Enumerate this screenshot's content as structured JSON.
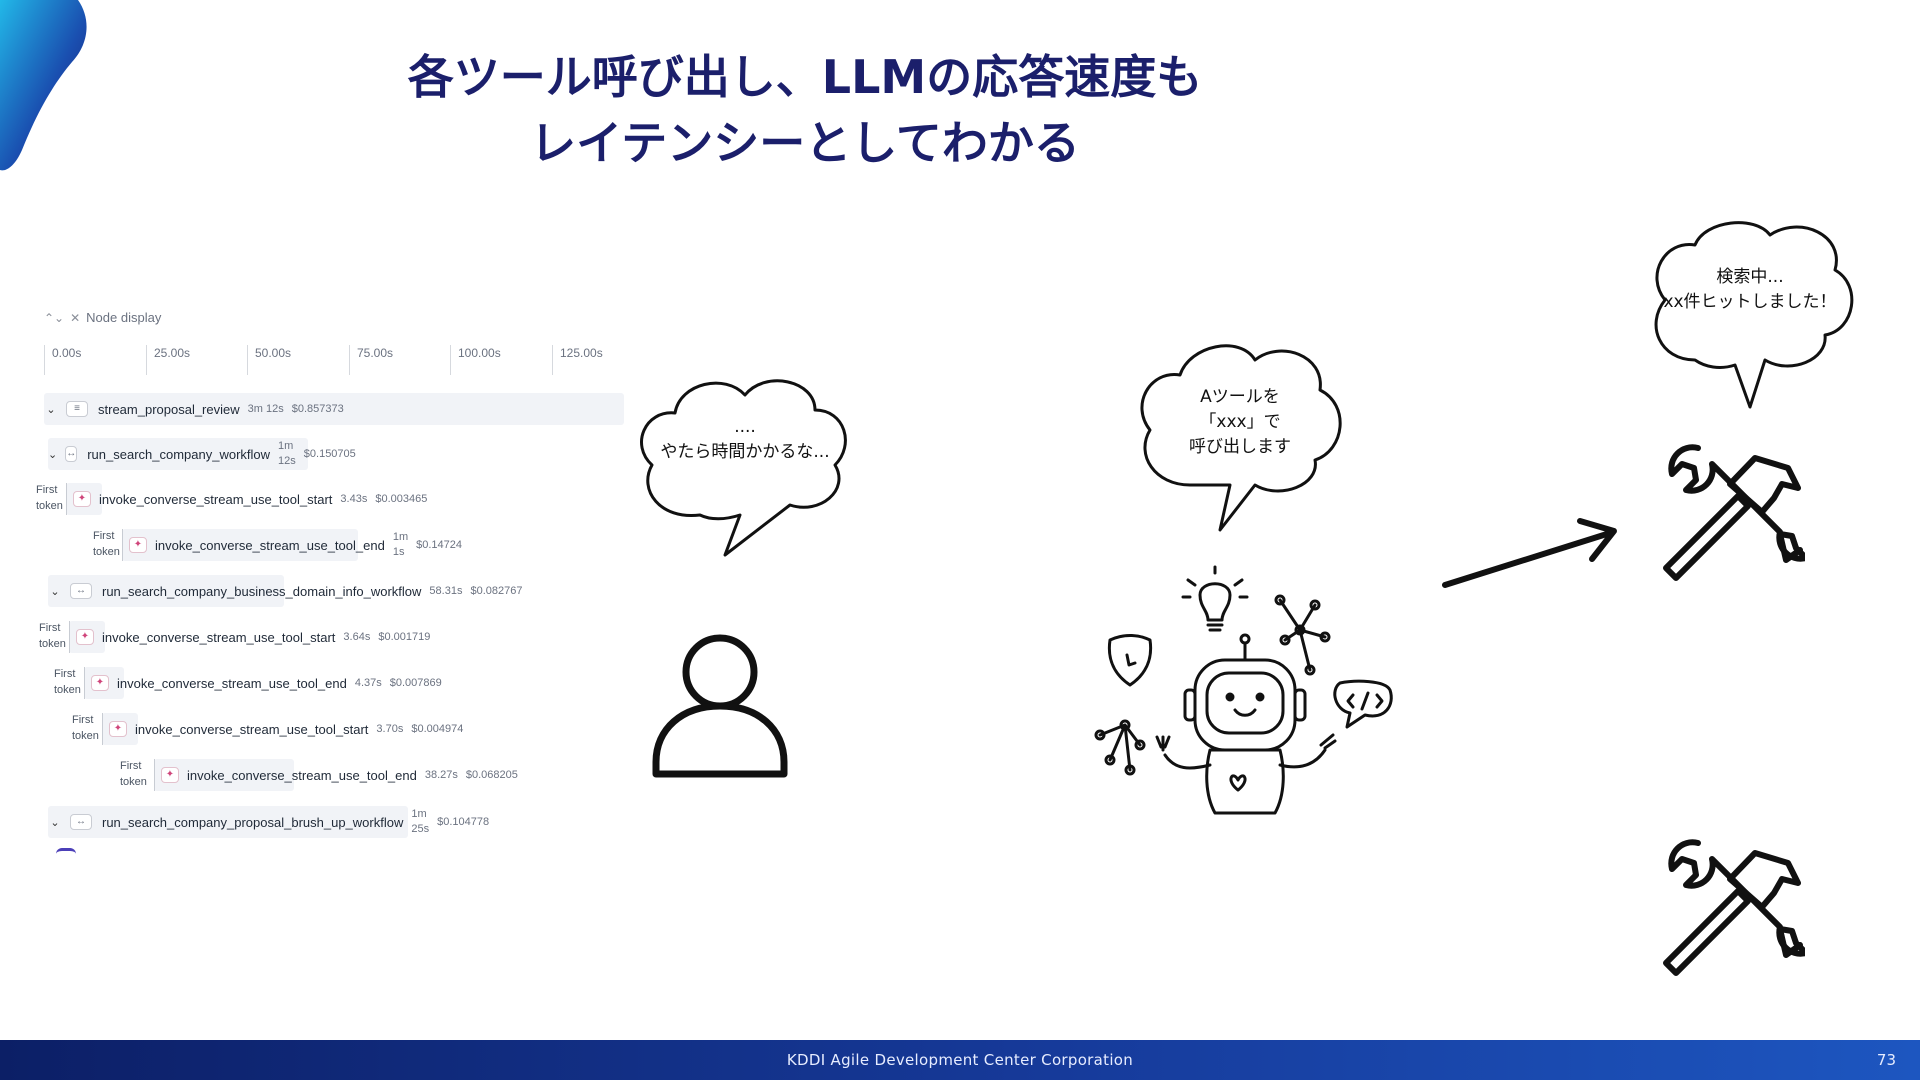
{
  "slide": {
    "title_line1": "各ツール呼び出し、LLMの応答速度も",
    "title_line2": "レイテンシーとしてわかる",
    "footer_company": "KDDI Agile Development Center Corporation",
    "page_number": "73"
  },
  "trace": {
    "node_display_label": "Node display",
    "ticks": [
      "0.00s",
      "25.00s",
      "50.00s",
      "75.00s",
      "100.00s",
      "125.00s"
    ],
    "rows": [
      {
        "name": "stream_proposal_review",
        "duration": "3m 12s",
        "cost": "$0.857373"
      },
      {
        "name": "run_search_company_workflow",
        "duration_a": "1m",
        "duration_b": "12s",
        "cost": "$0.150705"
      },
      {
        "first_a": "First",
        "first_b": "token",
        "name": "invoke_converse_stream_use_tool_start",
        "duration": "3.43s",
        "cost": "$0.003465"
      },
      {
        "first_a": "First",
        "first_b": "token",
        "name": "invoke_converse_stream_use_tool_end",
        "duration_a": "1m",
        "duration_b": "1s",
        "cost": "$0.14724"
      },
      {
        "name": "run_search_company_business_domain_info_workflow",
        "duration": "58.31s",
        "cost": "$0.082767"
      },
      {
        "first_a": "First",
        "first_b": "token",
        "name": "invoke_converse_stream_use_tool_start",
        "duration": "3.64s",
        "cost": "$0.001719"
      },
      {
        "first_a": "First",
        "first_b": "token",
        "name": "invoke_converse_stream_use_tool_end",
        "duration": "4.37s",
        "cost": "$0.007869"
      },
      {
        "first_a": "First",
        "first_b": "token",
        "name": "invoke_converse_stream_use_tool_start",
        "duration": "3.70s",
        "cost": "$0.004974"
      },
      {
        "first_a": "First",
        "first_b": "token",
        "name": "invoke_converse_stream_use_tool_end",
        "duration": "38.27s",
        "cost": "$0.068205"
      },
      {
        "name": "run_search_company_proposal_brush_up_workflow",
        "duration_a": "1m",
        "duration_b": "25s",
        "cost": "$0.104778"
      }
    ]
  },
  "bubbles": {
    "user_line1": "....",
    "user_line2": "やたら時間かかるな...",
    "agent_line1": "Aツールを",
    "agent_line2": "「xxx」で",
    "agent_line3": "呼び出します",
    "tool_line1": "検索中...",
    "tool_line2": "xx件ヒットしました！"
  },
  "icons": {
    "user": "user-icon",
    "robot": "robot-icon",
    "arrow": "arrow-icon",
    "tools": "tools-icon"
  },
  "colors": {
    "title": "#1b1f6b",
    "footer_start": "#0c1f66",
    "footer_end": "#1d56c0"
  }
}
